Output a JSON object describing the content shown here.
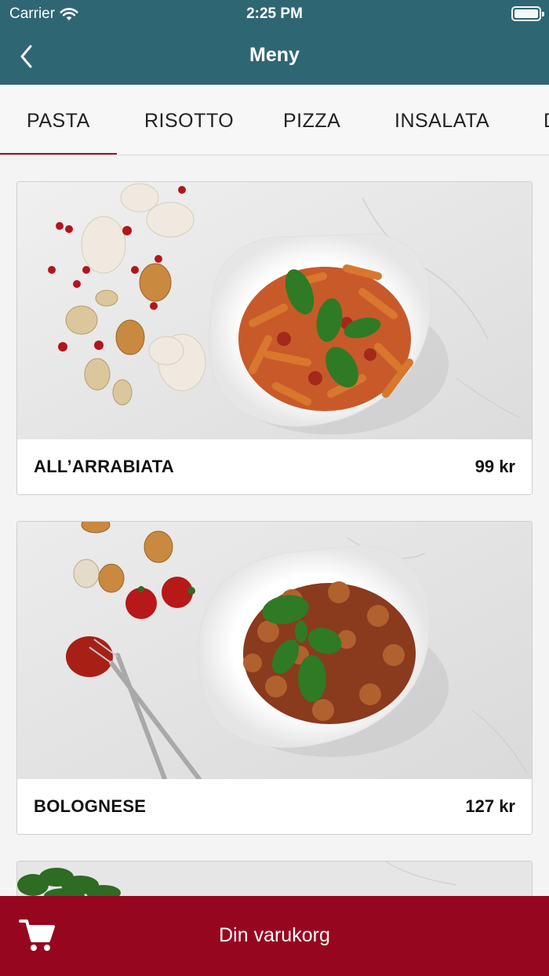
{
  "status_bar": {
    "carrier": "Carrier",
    "time": "2:25 PM"
  },
  "nav": {
    "title": "Meny",
    "back_icon": "chevron-left-icon"
  },
  "tabs": [
    {
      "label": "PASTA",
      "active": true
    },
    {
      "label": "RISOTTO",
      "active": false
    },
    {
      "label": "PIZZA",
      "active": false
    },
    {
      "label": "INSALATA",
      "active": false
    },
    {
      "label": "D",
      "active": false
    }
  ],
  "menu_items": [
    {
      "name": "ALL’ARRABIATA",
      "price": "99 kr",
      "image": "penne-arrabbiata-plate-photo"
    },
    {
      "name": "BOLOGNESE",
      "price": "127 kr",
      "image": "fusilli-bolognese-plate-photo"
    },
    {
      "name": "",
      "price": "",
      "image": "herb-dish-photo-partial"
    }
  ],
  "cart": {
    "label": "Din varukorg",
    "icon": "shopping-cart-icon"
  },
  "colors": {
    "header": "#2f6674",
    "accent": "#9a1026",
    "cart_bar": "#97061f"
  }
}
